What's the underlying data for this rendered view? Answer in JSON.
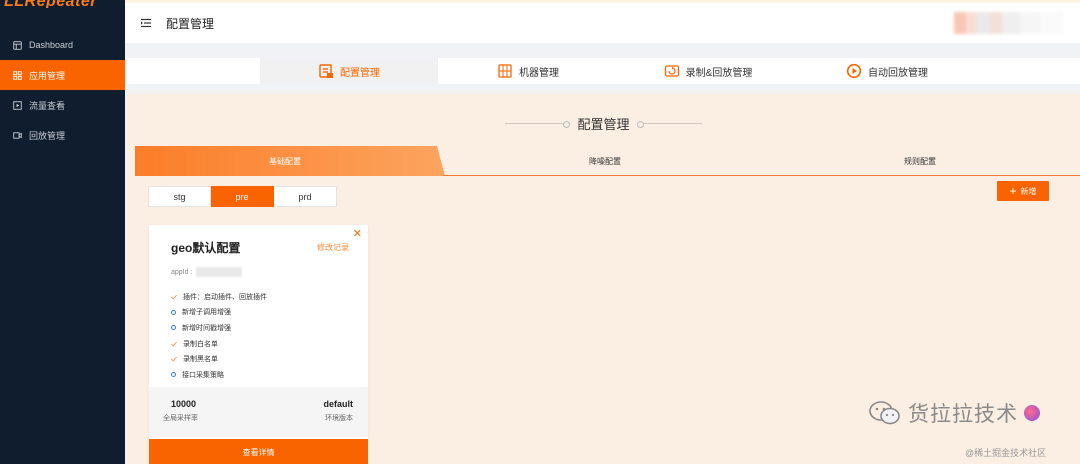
{
  "sidebar": {
    "brand": "LLRepeater",
    "items": [
      {
        "label": "Dashboard",
        "icon": "layout-icon",
        "active": false
      },
      {
        "label": "应用管理",
        "icon": "grid-icon",
        "active": true
      },
      {
        "label": "流量查看",
        "icon": "play-square-icon",
        "active": false
      },
      {
        "label": "回放管理",
        "icon": "video-icon",
        "active": false
      }
    ]
  },
  "header": {
    "title": "配置管理"
  },
  "tabs": [
    {
      "label": "配置管理",
      "icon": "config-doc-icon",
      "active": true
    },
    {
      "label": "机器管理",
      "icon": "server-icon",
      "active": false
    },
    {
      "label": "录制&回放管理",
      "icon": "record-replay-icon",
      "active": false
    },
    {
      "label": "自动回放管理",
      "icon": "auto-replay-icon",
      "active": false
    }
  ],
  "panel": {
    "title": "配置管理",
    "subtabs": [
      {
        "label": "基础配置",
        "active": true
      },
      {
        "label": "降噪配置",
        "active": false
      },
      {
        "label": "规则配置",
        "active": false
      }
    ],
    "envs": [
      {
        "label": "stg",
        "active": false
      },
      {
        "label": "pre",
        "active": true
      },
      {
        "label": "prd",
        "active": false
      }
    ],
    "add_label": "新增"
  },
  "card": {
    "title": "geo默认配置",
    "history_link": "修改记录",
    "appid_label": "appId :",
    "features": [
      {
        "label": "插件：启动插件、回放插件",
        "checked": true
      },
      {
        "label": "新增子调用增强",
        "checked": false
      },
      {
        "label": "新增时间戳增强",
        "checked": false
      },
      {
        "label": "录制白名单",
        "checked": true
      },
      {
        "label": "录制黑名单",
        "checked": true
      },
      {
        "label": "接口采集策略",
        "checked": false
      }
    ],
    "sample_rate": {
      "value": "10000",
      "label": "全局采样率"
    },
    "env_version": {
      "value": "default",
      "label": "环境版本"
    },
    "detail_label": "查看详情"
  },
  "watermark": {
    "main": "货拉拉技术",
    "sub": "@稀土掘金技术社区"
  },
  "colors": {
    "accent": "#fa6400",
    "sidebar_bg": "#0f1d2e",
    "panel_bg": "#fbefe3",
    "check": "#f28a3a",
    "circle": "#2f7fd8"
  }
}
